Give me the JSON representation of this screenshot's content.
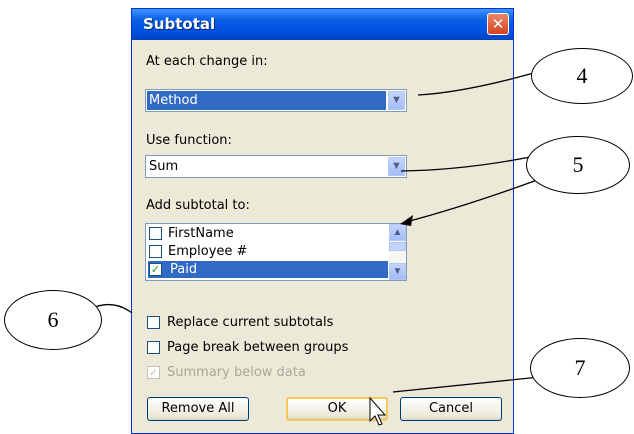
{
  "dialog": {
    "title": "Subtotal",
    "close_glyph": "✕",
    "change_label": "At each change in:",
    "change_value": "Method",
    "function_label": "Use function:",
    "function_value": "Sum",
    "add_label": "Add subtotal to:",
    "list_items": [
      {
        "label": "FirstName",
        "checked": false
      },
      {
        "label": "Employee #",
        "checked": false
      },
      {
        "label": "Paid",
        "checked": true
      }
    ],
    "options": [
      {
        "label": "Replace current subtotals",
        "checked": false
      },
      {
        "label": "Page break between groups",
        "checked": false
      },
      {
        "label": "Summary below data",
        "checked": true
      }
    ],
    "buttons": {
      "remove_all": "Remove All",
      "ok": "OK",
      "cancel": "Cancel"
    }
  },
  "callouts": {
    "c4": "4",
    "c5": "5",
    "c6": "6",
    "c7": "7"
  },
  "icons": {
    "dropdown": "chevron-down-icon",
    "check": "checkmark-icon",
    "close": "close-icon",
    "cursor": "mouse-pointer-icon"
  },
  "colors": {
    "selection": "#316ac5",
    "titlebar": "#0054e3",
    "dialog_bg": "#ece9d8"
  }
}
